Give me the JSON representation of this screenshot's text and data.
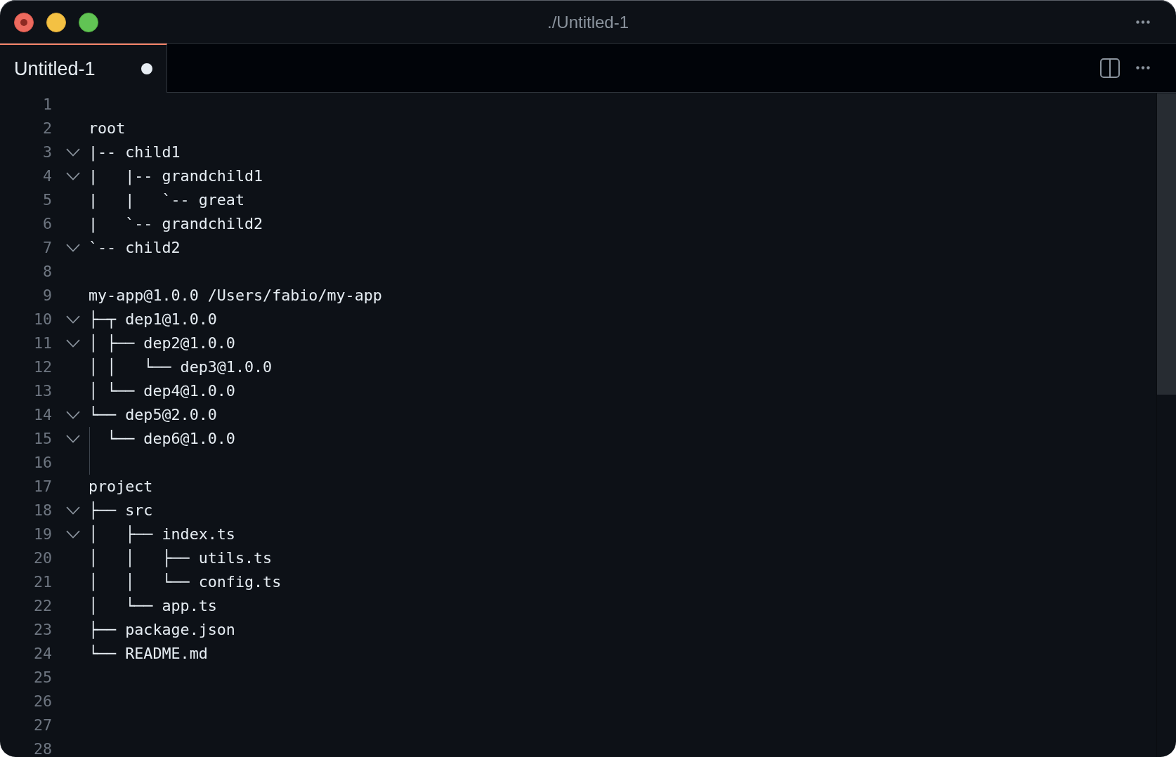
{
  "window": {
    "title": "./Untitled-1"
  },
  "tabs": [
    {
      "label": "Untitled-1",
      "selected": true,
      "modified": true
    }
  ],
  "editor": {
    "lines": [
      {
        "number": "1",
        "fold_marker": false,
        "indent_guide": false
      },
      {
        "number": "2",
        "text": "root",
        "fold_marker": false,
        "indent_guide": false
      },
      {
        "number": "3",
        "text": "|-- child1",
        "fold_marker": true,
        "indent_guide": false
      },
      {
        "number": "4",
        "text": "|   |-- grandchild1",
        "fold_marker": true,
        "indent_guide": false
      },
      {
        "number": "5",
        "text": "|   |   `-- great",
        "fold_marker": false,
        "indent_guide": false
      },
      {
        "number": "6",
        "text": "|   `-- grandchild2",
        "fold_marker": false,
        "indent_guide": false
      },
      {
        "number": "7",
        "text": "`-- child2",
        "fold_marker": true,
        "indent_guide": false
      },
      {
        "number": "8",
        "fold_marker": false,
        "indent_guide": false
      },
      {
        "number": "9",
        "text": "my-app@1.0.0 /Users/fabio/my-app",
        "fold_marker": false,
        "indent_guide": false
      },
      {
        "number": "10",
        "text": "├─┬ dep1@1.0.0",
        "fold_marker": true,
        "indent_guide": false
      },
      {
        "number": "11",
        "text": "│ ├── dep2@1.0.0",
        "fold_marker": true,
        "indent_guide": false
      },
      {
        "number": "12",
        "text": "│ │   └── dep3@1.0.0",
        "fold_marker": false,
        "indent_guide": false
      },
      {
        "number": "13",
        "text": "│ └── dep4@1.0.0",
        "fold_marker": false,
        "indent_guide": false
      },
      {
        "number": "14",
        "text": "└── dep5@2.0.0",
        "fold_marker": true,
        "indent_guide": false
      },
      {
        "number": "15",
        "text": "  └── dep6@1.0.0",
        "fold_marker": true,
        "indent_guide": true
      },
      {
        "number": "16",
        "fold_marker": false,
        "indent_guide": true
      },
      {
        "number": "17",
        "text": "project",
        "fold_marker": false,
        "indent_guide": false
      },
      {
        "number": "18",
        "text": "├── src",
        "fold_marker": true,
        "indent_guide": false
      },
      {
        "number": "19",
        "text": "│   ├── index.ts",
        "fold_marker": true,
        "indent_guide": false
      },
      {
        "number": "20",
        "text": "│   │   ├── utils.ts",
        "fold_marker": false,
        "indent_guide": false
      },
      {
        "number": "21",
        "text": "│   │   └── config.ts",
        "fold_marker": false,
        "indent_guide": false
      },
      {
        "number": "22",
        "text": "│   └── app.ts",
        "fold_marker": false,
        "indent_guide": false
      },
      {
        "number": "23",
        "text": "├── package.json",
        "fold_marker": false,
        "indent_guide": false
      },
      {
        "number": "24",
        "text": "└── README.md",
        "fold_marker": false,
        "indent_guide": false
      },
      {
        "number": "25",
        "fold_marker": false,
        "indent_guide": false
      },
      {
        "number": "26",
        "fold_marker": false,
        "indent_guide": false
      },
      {
        "number": "27",
        "fold_marker": false,
        "indent_guide": false
      },
      {
        "number": "28",
        "fold_marker": false,
        "indent_guide": false
      }
    ]
  }
}
